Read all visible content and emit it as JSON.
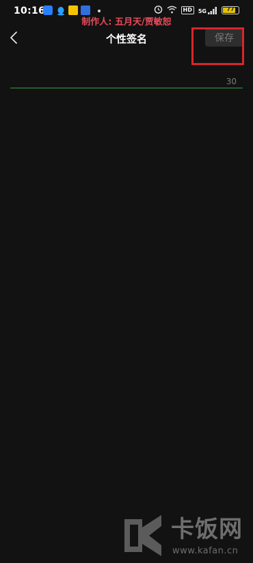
{
  "status_bar": {
    "time": "10:16",
    "network": "5G",
    "hd": "HD",
    "battery": "77"
  },
  "watermark_top": "制作人: 五月天/贾敏恕",
  "header": {
    "title": "个性签名",
    "save_label": "保存"
  },
  "signature": {
    "value": "",
    "counter": "30"
  },
  "logo": {
    "brand": "卡饭网",
    "url": "www.kafan.cn"
  },
  "colors": {
    "background": "#121212",
    "accent_line": "#2ea34a",
    "highlight": "#d8262b"
  }
}
